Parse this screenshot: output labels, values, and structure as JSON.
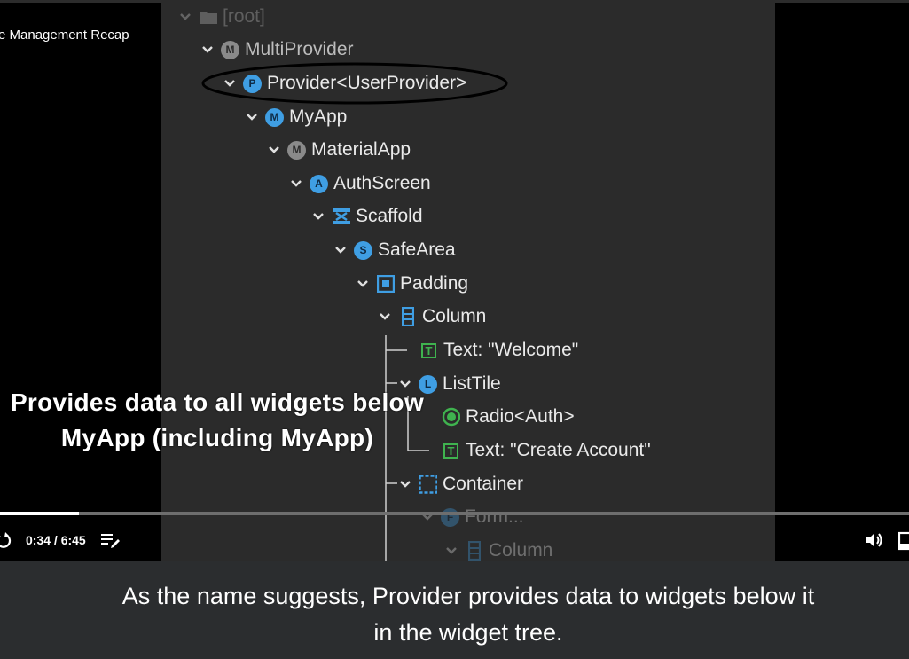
{
  "video": {
    "title": "e Management Recap",
    "time": "0:34 / 6:45",
    "progress_fraction": 0.087
  },
  "tree": {
    "root_label": "[root]",
    "nodes": [
      {
        "label": "MultiProvider",
        "badge": "M"
      },
      {
        "label": "Provider<UserProvider>",
        "badge": "P"
      },
      {
        "label": "MyApp",
        "badge": "M"
      },
      {
        "label": "MaterialApp",
        "badge": "M"
      },
      {
        "label": "AuthScreen",
        "badge": "A"
      },
      {
        "label": "Scaffold",
        "badge": "scaffold-icon"
      },
      {
        "label": "SafeArea",
        "badge": "S"
      },
      {
        "label": "Padding",
        "badge": "padding-icon"
      },
      {
        "label": "Column",
        "badge": "column-icon"
      },
      {
        "label": "Text: \"Welcome\"",
        "badge": "T"
      },
      {
        "label": "ListTile",
        "badge": "L"
      },
      {
        "label": "Radio<Auth>",
        "badge": "radio-icon"
      },
      {
        "label": "Text: \"Create Account\"",
        "badge": "T"
      },
      {
        "label": "Container",
        "badge": "container-icon"
      },
      {
        "label": "Form...",
        "badge": "F"
      },
      {
        "label": "Column",
        "badge": "column-icon"
      }
    ]
  },
  "annotation": {
    "line1": "Provides data to all widgets below",
    "line2": "MyApp (including MyApp)"
  },
  "caption": {
    "line1": "As the name suggests, Provider provides data to widgets below it",
    "line2": "in the widget tree."
  },
  "colors": {
    "badge_blue": "#3f9ee3",
    "text_green": "#3fb34f",
    "panel_bg": "#2b2b2b",
    "caption_bg": "#2b2d2f"
  }
}
